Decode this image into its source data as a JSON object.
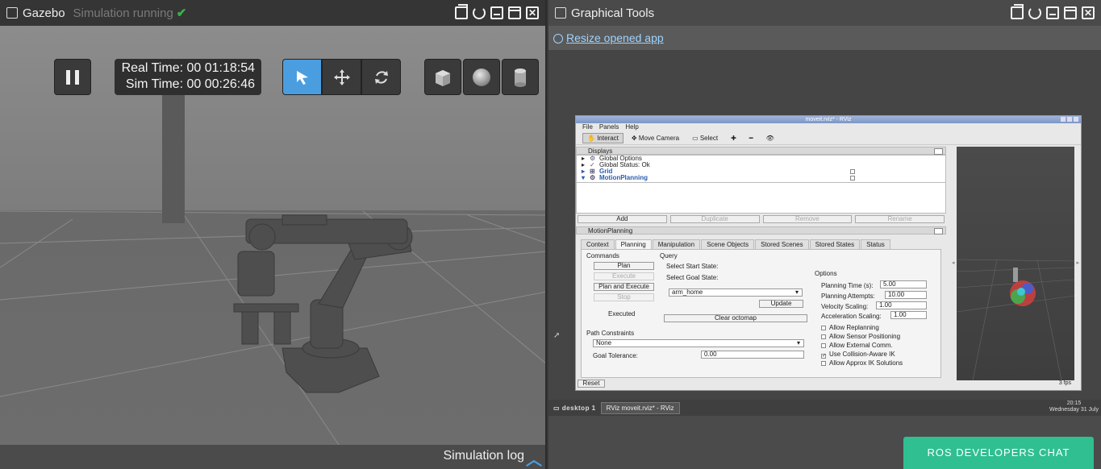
{
  "gazebo": {
    "title": "Gazebo",
    "status": "Simulation running",
    "status_check": "✔",
    "real_time": "Real Time: 00 01:18:54",
    "sim_time": "Sim Time: 00 00:26:46",
    "sim_log": "Simulation log"
  },
  "gtools": {
    "title": "Graphical Tools",
    "resize_link": "Resize opened app"
  },
  "rviz": {
    "title": "moveit.rviz* - RViz",
    "menu": [
      "File",
      "Panels",
      "Help"
    ],
    "toolbar": {
      "interact": "Interact",
      "move_camera": "Move Camera",
      "select": "Select"
    },
    "displays_header": "Displays",
    "displays": [
      {
        "label": "Global Options"
      },
      {
        "label": "Global Status: Ok"
      },
      {
        "label": "Grid"
      },
      {
        "label": "MotionPlanning"
      }
    ],
    "display_buttons": [
      "Add",
      "Duplicate",
      "Remove",
      "Rename"
    ],
    "motion_header": "MotionPlanning",
    "tabs": [
      "Context",
      "Planning",
      "Manipulation",
      "Scene Objects",
      "Stored Scenes",
      "Stored States",
      "Status"
    ],
    "commands": {
      "title": "Commands",
      "plan": "Plan",
      "execute": "Execute",
      "plan_execute": "Plan and Execute",
      "stop": "Stop",
      "status": "Executed"
    },
    "query": {
      "title": "Query",
      "start": "Select Start State:",
      "goal": "Select Goal State:",
      "goal_value": "arm_home",
      "update": "Update",
      "clear": "Clear octomap"
    },
    "path": {
      "title": "Path Constraints",
      "value": "None",
      "tolerance_label": "Goal Tolerance:",
      "tolerance": "0.00"
    },
    "options": {
      "title": "Options",
      "planning_time_label": "Planning Time (s):",
      "planning_time": "5.00",
      "attempts_label": "Planning Attempts:",
      "attempts": "10.00",
      "velocity_label": "Velocity Scaling:",
      "velocity": "1.00",
      "accel_label": "Acceleration Scaling:",
      "accel": "1.00",
      "checks": [
        {
          "label": "Allow Replanning",
          "checked": false
        },
        {
          "label": "Allow Sensor Positioning",
          "checked": false
        },
        {
          "label": "Allow External Comm.",
          "checked": false
        },
        {
          "label": "Use Collision-Aware IK",
          "checked": true
        },
        {
          "label": "Allow Approx IK Solutions",
          "checked": false
        }
      ]
    },
    "reset": "Reset",
    "fps": "3 fps"
  },
  "taskbar": {
    "desktop": "desktop 1",
    "task": "RViz moveit.rviz* - RViz",
    "time": "20:15",
    "date": "Wednesday 31 July"
  },
  "ros_chat": "ROS DEVELOPERS CHAT",
  "colors": {
    "accent": "#4a9ee0",
    "chat": "#2fbf90",
    "check": "#3bb24a"
  }
}
